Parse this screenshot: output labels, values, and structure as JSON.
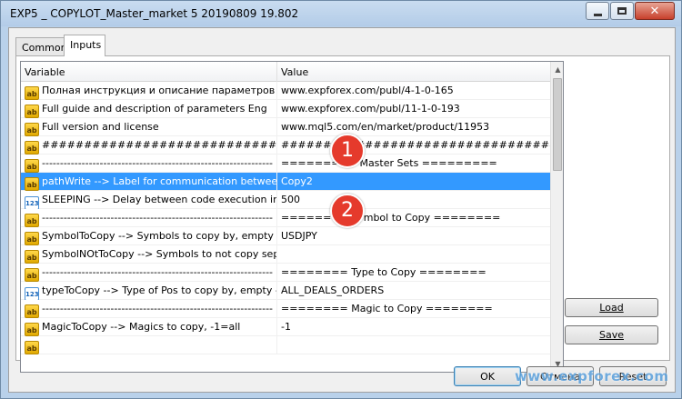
{
  "window": {
    "title": "EXP5 _ COPYLOT_Master_market 5 20190809 19.802",
    "minimize_glyph": "",
    "close_glyph": "✕"
  },
  "tabs": [
    {
      "label": "Common"
    },
    {
      "label": "Inputs"
    }
  ],
  "grid": {
    "headers": {
      "variable": "Variable",
      "value": "Value"
    },
    "rows": [
      {
        "icon": "ab",
        "variable": "Полная инструкция и описание параметров Рус",
        "value": "www.expforex.com/publ/4-1-0-165"
      },
      {
        "icon": "ab",
        "variable": "Full guide and description of parameters Eng",
        "value": "www.expforex.com/publ/11-1-0-193"
      },
      {
        "icon": "ab",
        "variable": "Full version and license",
        "value": "www.mql5.com/en/market/product/11953"
      },
      {
        "icon": "ab",
        "variable": "##########################################",
        "value": "##########################################"
      },
      {
        "icon": "ab",
        "variable": "----------------------------------------------------------------",
        "value": "========= Master Sets ========="
      },
      {
        "icon": "ab",
        "variable": "pathWrite --> Label for communication between te...",
        "value": "Copy2"
      },
      {
        "icon": "123",
        "variable": "SLEEPING --> Delay between code execution in mill...",
        "value": "500"
      },
      {
        "icon": "ab",
        "variable": "----------------------------------------------------------------",
        "value": "======== Symbol to Copy ========"
      },
      {
        "icon": "ab",
        "variable": "SymbolToCopy --> Symbols to copy by, empty - all...",
        "value": "USDJPY"
      },
      {
        "icon": "ab",
        "variable": "SymbolNOtToCopy --> Symbols to not copy separa...",
        "value": ""
      },
      {
        "icon": "ab",
        "variable": "----------------------------------------------------------------",
        "value": "======== Type to Copy ========"
      },
      {
        "icon": "123",
        "variable": "typeToCopy --> Type of Pos to copy by, empty - a...",
        "value": "ALL_DEALS_ORDERS"
      },
      {
        "icon": "ab",
        "variable": "----------------------------------------------------------------",
        "value": "======== Magic to Copy ========"
      },
      {
        "icon": "ab",
        "variable": "MagicToCopy --> Magics to copy, -1=all",
        "value": "-1"
      },
      {
        "icon": "ab",
        "variable": "",
        "value": ""
      }
    ],
    "selected_row": 5,
    "scroll_up_glyph": "▲",
    "scroll_down_glyph": "▼"
  },
  "annotations": [
    {
      "label": "1"
    },
    {
      "label": "2"
    }
  ],
  "buttons": {
    "load": "Load",
    "save": "Save",
    "ok": "OK",
    "cancel": "Отмена",
    "reset": "Reset"
  },
  "watermark": "www.expforex.com",
  "colors": {
    "selection": "#3399ff",
    "badge": "#e53a2c",
    "icon_ab": "#ffd84a",
    "icon_123": "#1463b8"
  }
}
